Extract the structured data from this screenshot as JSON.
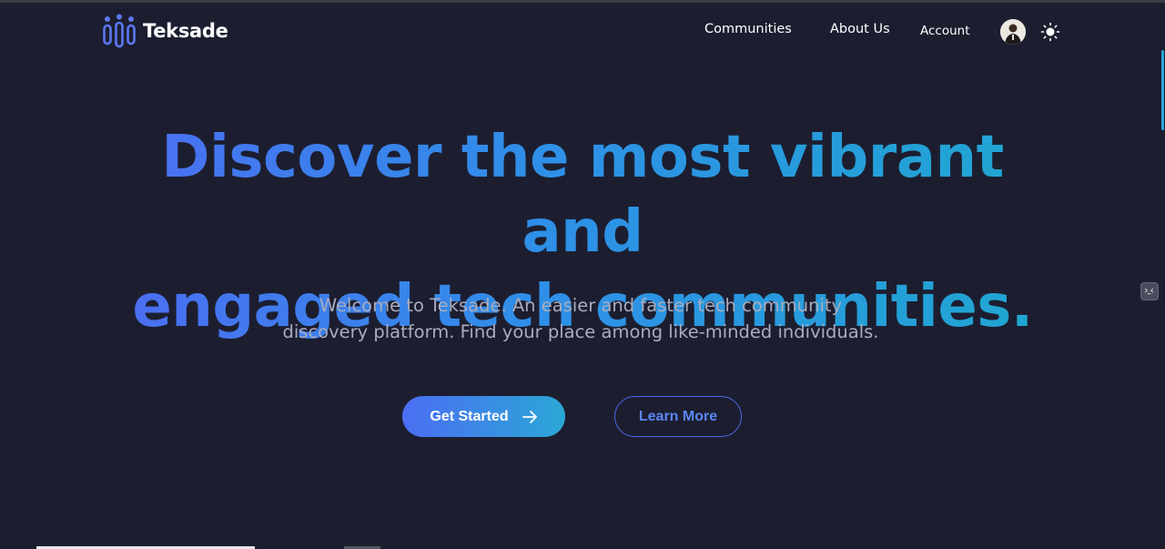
{
  "brand": {
    "name": "Teksade",
    "accent": "#4b6ef3"
  },
  "nav": {
    "communities": "Communities",
    "about": "About Us",
    "account": "Account"
  },
  "hero": {
    "headline_line1": "Discover the most vibrant and",
    "headline_line2": "engaged tech communities.",
    "subtext": "Welcome to Teksade. An easier and faster tech community discovery platform. Find your place among like-minded individuals.",
    "primary_cta": "Get Started",
    "secondary_cta": "Learn More"
  },
  "icons": {
    "logo": "people-logo-icon",
    "theme": "sun-icon",
    "cta_arrow": "arrow-right-icon",
    "widget": "chat-widget-icon"
  },
  "colors": {
    "background": "#1c1e30",
    "gradient_start": "#4b6ef3",
    "gradient_end": "#2ba7d6",
    "subtext": "#a9acbd"
  }
}
